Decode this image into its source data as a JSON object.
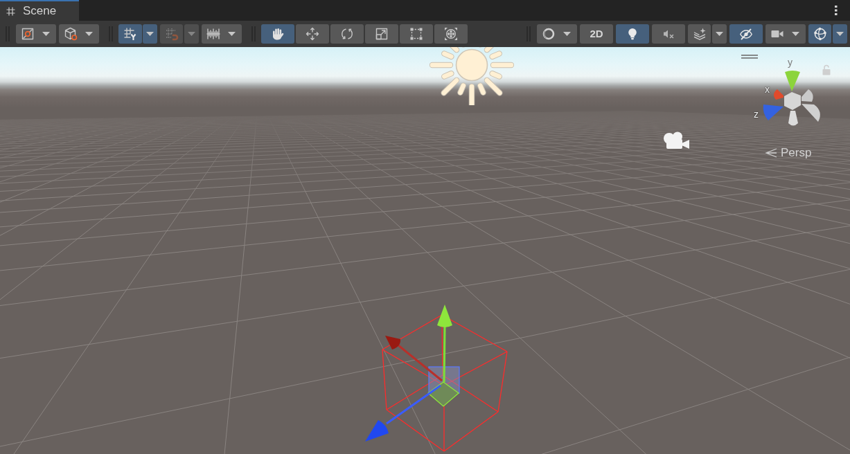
{
  "tabs": [
    {
      "label": "Scene",
      "selected": true
    }
  ],
  "toolbar": {
    "grid_snapping": {
      "selected": true
    },
    "increment_snapping": {
      "disabled": true
    },
    "tools": [
      {
        "kind": "hand",
        "selected": true
      },
      {
        "kind": "move",
        "selected": false
      },
      {
        "kind": "rotate",
        "selected": false
      },
      {
        "kind": "scale",
        "selected": false
      },
      {
        "kind": "rect",
        "selected": false
      },
      {
        "kind": "transform",
        "selected": false
      }
    ],
    "mode_2d": {
      "label": "2D",
      "selected": false
    },
    "lighting": {
      "selected": true
    },
    "audio": {
      "selected": false
    },
    "effects": {
      "selected": false
    },
    "scene_visibility": {
      "selected": true
    },
    "gizmos": {
      "selected": true
    }
  },
  "scene_view": {
    "orientation_gizmo": {
      "axes": [
        {
          "label": "y",
          "color": "#8cd43c"
        },
        {
          "label": "x",
          "color": "#e04a2c"
        },
        {
          "label": "z",
          "color": "#3462e0"
        }
      ],
      "projection": "Persp"
    }
  }
}
